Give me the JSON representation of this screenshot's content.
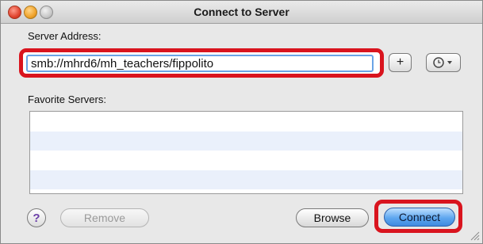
{
  "window": {
    "title": "Connect to Server"
  },
  "server": {
    "label": "Server Address:",
    "value": "smb://mhrd6/mh_teachers/fippolito",
    "add_label": "+",
    "history_icon": "clock-dropdown-icon"
  },
  "favorites": {
    "label": "Favorite Servers:"
  },
  "buttons": {
    "help": "?",
    "remove": "Remove",
    "browse": "Browse",
    "connect": "Connect"
  },
  "colors": {
    "highlight": "#d9141e",
    "focus_ring": "#6aa4e6",
    "connect_blue": "#5ea7ef",
    "help_purple": "#6b3fa8",
    "alt_row": "#eaf0fb"
  }
}
